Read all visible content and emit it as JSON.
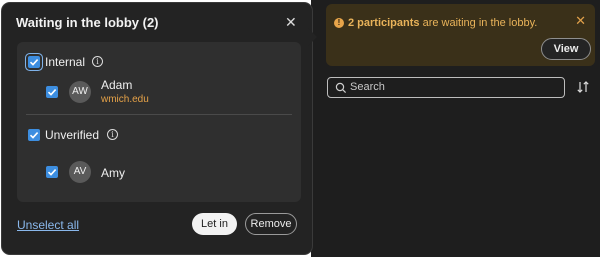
{
  "lobby": {
    "title": "Waiting in the lobby (2)",
    "groups": [
      {
        "label": "Internal",
        "checked": true,
        "participants": [
          {
            "initials": "AW",
            "name": "Adam",
            "domain": "wmich.edu",
            "checked": true
          }
        ]
      },
      {
        "label": "Unverified",
        "checked": true,
        "participants": [
          {
            "initials": "AV",
            "name": "Amy",
            "checked": true
          }
        ]
      }
    ],
    "unselect_all_label": "Unselect all",
    "let_in_label": "Let in",
    "remove_label": "Remove"
  },
  "banner": {
    "count_text": "2 participants",
    "message_text": "are waiting in the lobby.",
    "view_label": "View"
  },
  "search": {
    "placeholder": "Search"
  },
  "colors": {
    "panel_bg": "#232323",
    "list_bg": "#2f2f2f",
    "checkbox": "#3d8ee0",
    "banner_bg": "#3a3019",
    "banner_text": "#e9b35a",
    "domain_text": "#e5a248",
    "link": "#8ab8ec"
  },
  "icons": [
    "close-icon",
    "info-icon",
    "checkbox-checked-icon",
    "warning-icon",
    "search-icon",
    "sort-icon"
  ]
}
